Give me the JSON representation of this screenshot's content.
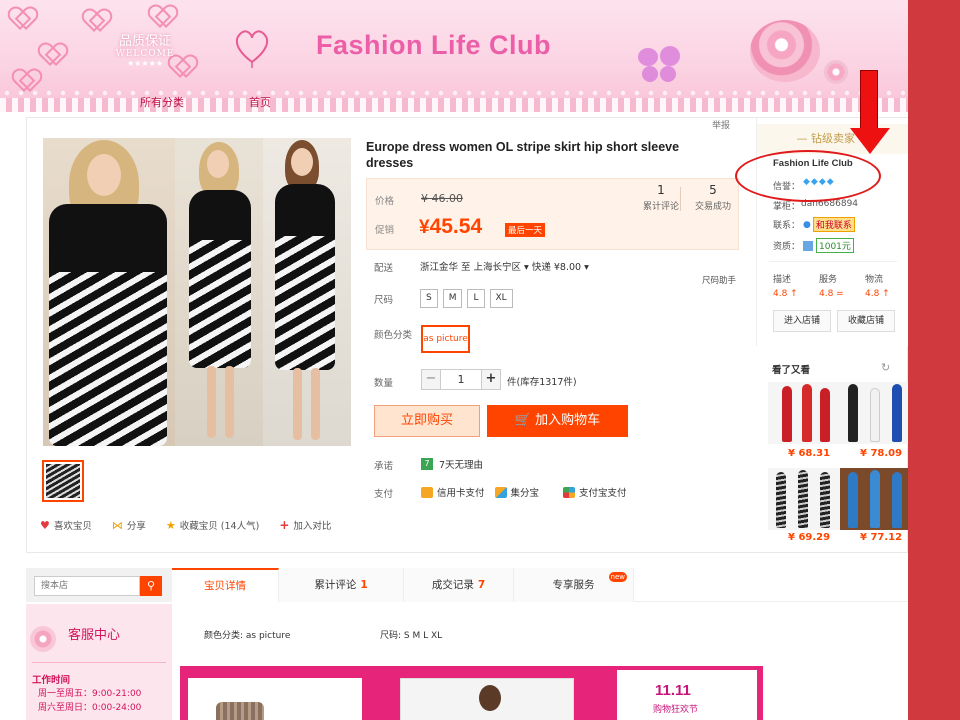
{
  "banner": {
    "quality_cn": "品质保证",
    "quality_en": "WELCOME",
    "quality_stars": "★★★★★",
    "shop_title": "Fashion Life Club",
    "nav_all": "所有分类",
    "nav_home": "首页"
  },
  "report": "举报",
  "product": {
    "title": "Europe dress women OL stripe skirt hip short sleeve dresses",
    "price_label": "价格",
    "original_price": "¥ 46.00",
    "promo_label": "促销",
    "currency": "¥",
    "promo_price": "45.54",
    "promo_tag": "最后一天",
    "stats": [
      {
        "value": "1",
        "label": "累计评论"
      },
      {
        "value": "5",
        "label": "交易成功"
      }
    ],
    "delivery_label": "配送",
    "delivery_value": "浙江金华 至 上海长宁区 ▾ 快递 ¥8.00 ▾",
    "size_helper": "尺码助手",
    "size_label": "尺码",
    "sizes": [
      "S",
      "M",
      "L",
      "XL"
    ],
    "color_label": "颜色分类",
    "color_value": "as picture",
    "qty_label": "数量",
    "qty_value": "1",
    "qty_minus": "−",
    "qty_plus": "+",
    "stock": "件(库存1317件)",
    "buy_now": "立即购买",
    "add_cart": "加入购物车",
    "promise_label": "承诺",
    "promise_icon": "7",
    "promise_value": "7天无理由",
    "pay_label": "支付",
    "pay_methods": [
      "信用卡支付",
      "集分宝",
      "支付宝支付"
    ]
  },
  "actions": {
    "like": "喜欢宝贝",
    "share": "分享",
    "favorite": "收藏宝贝 (14人气)",
    "compare": "加入对比"
  },
  "shop": {
    "level": "— 钻级卖家 —",
    "name": "Fashion Life Club",
    "credit_label": "信誉：",
    "credit_value": "◆◆◆◆",
    "keeper_label": "掌柜：",
    "keeper_value": "dan6686894",
    "contact_label": "联系：",
    "contact_value": "和我联系",
    "cert_label": "资质：",
    "cert_value": "1001元",
    "scores": [
      {
        "label": "描述",
        "value": "4.8 ↑"
      },
      {
        "label": "服务",
        "value": "4.8 ="
      },
      {
        "label": "物流",
        "value": "4.8 ↑"
      }
    ],
    "enter_shop": "进入店铺",
    "favorite_shop": "收藏店铺"
  },
  "also_viewed": {
    "title": "看了又看",
    "refresh_icon": "↻",
    "prices": [
      "¥ 68.31",
      "¥ 78.09",
      "¥ 69.29",
      "¥ 77.12"
    ]
  },
  "lower": {
    "search_placeholder": "搜本店",
    "search_icon": "search-icon",
    "service_title": "客服中心",
    "work_title": "工作时间",
    "work_weekday": "周一至周五：9:00-21:00",
    "work_weekend": "周六至周日：0:00-24:00",
    "tabs": [
      {
        "label": "宝贝详情",
        "count": ""
      },
      {
        "label": "累计评论",
        "count": "1"
      },
      {
        "label": "成交记录",
        "count": "7"
      },
      {
        "label": "专享服务",
        "count": ""
      }
    ],
    "new_badge": "new",
    "attr_color": "颜色分类: as picture",
    "attr_size": "尺码: S M L XL",
    "promo_title": "11.11",
    "promo_sub": "购物狂欢节"
  },
  "colors": {
    "accent": "#ff4400",
    "brand_pink": "#ec5fa8",
    "annotation_red": "#e01a1a"
  }
}
